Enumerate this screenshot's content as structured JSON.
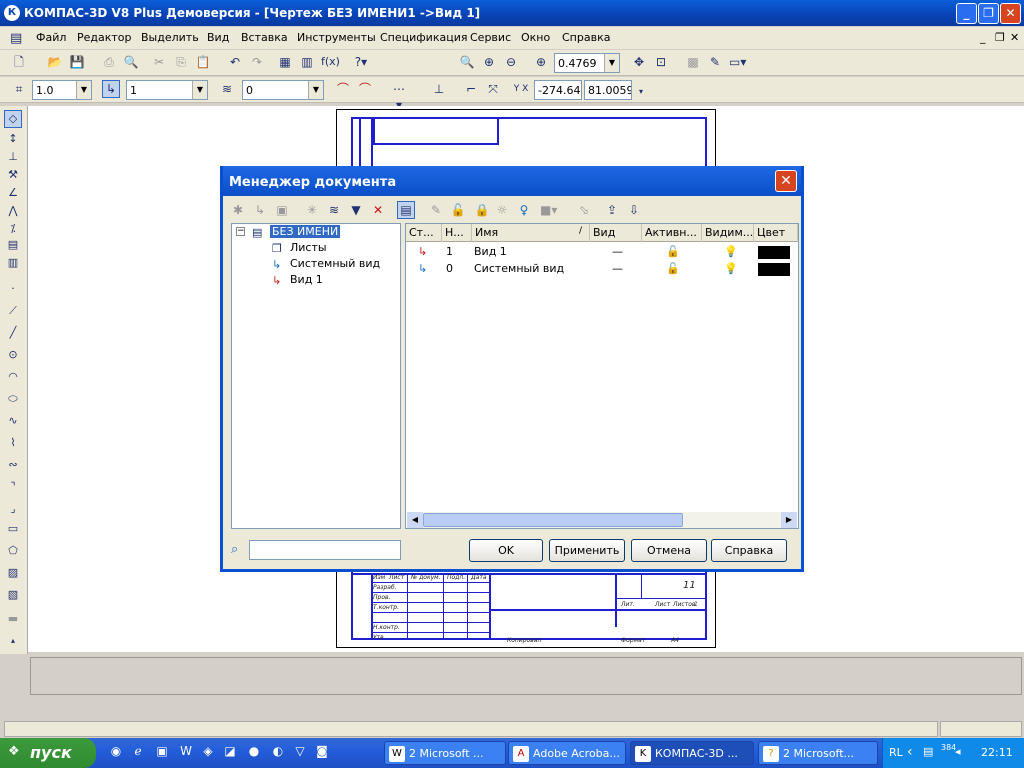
{
  "window": {
    "title": "КОМПАС-3D V8 Plus Демоверсия - [Чертеж БЕЗ ИМЕНИ1 ->Вид 1]",
    "app_icon": "К"
  },
  "menu": [
    "Файл",
    "Редактор",
    "Выделить",
    "Вид",
    "Вставка",
    "Инструменты",
    "Спецификация",
    "Сервис",
    "Окно",
    "Справка"
  ],
  "toolbar": {
    "zoom": "0.4769",
    "scale": "1.0",
    "layer": "1",
    "style": "0",
    "coord_x": "-274.64",
    "coord_y": "81.0059"
  },
  "drawing": {
    "sheet_number": "11",
    "labels": [
      "Изм",
      "Лист",
      "№ докум.",
      "Подп.",
      "Дата",
      "Разраб.",
      "Пров.",
      "Т.контр.",
      "Н.контр.",
      "Утв.",
      "Лит.",
      "Лист",
      "Листов",
      "1",
      "Копировал",
      "Формат",
      "А4"
    ]
  },
  "dialog": {
    "title": "Менеджер документа",
    "tree": [
      {
        "label": "БЕЗ ИМЕНИ",
        "selected": true
      },
      {
        "label": "Листы"
      },
      {
        "label": "Системный вид"
      },
      {
        "label": "Вид 1"
      }
    ],
    "columns": [
      "Ст...",
      "Н...",
      "Имя",
      "Вид",
      "Активн...",
      "Видим...",
      "Цвет"
    ],
    "sort_mark": "/",
    "rows": [
      {
        "number": "1",
        "name": "Вид 1",
        "vid": "—",
        "color": "#000000"
      },
      {
        "number": "0",
        "name": "Системный вид",
        "vid": "—",
        "color": "#000000"
      }
    ],
    "buttons": {
      "ok": "OK",
      "apply": "Применить",
      "cancel": "Отмена",
      "help": "Справка"
    },
    "search_value": ""
  },
  "taskbar": {
    "start": "пуск",
    "tasks": [
      "2 Microsoft ...",
      "Adobe Acroba...",
      "КОМПАС-3D ...",
      "2 Microsoft..."
    ],
    "lang": "RL",
    "clock": "22:11",
    "tray_badge": "384"
  }
}
